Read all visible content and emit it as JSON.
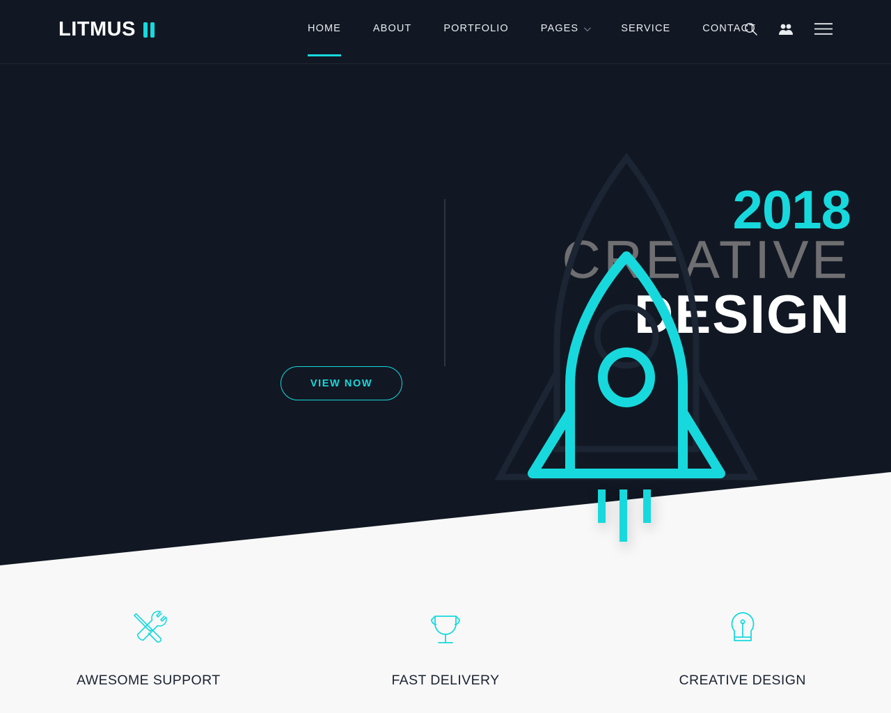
{
  "brand": {
    "name": "LITMUS",
    "accent_color": "#17d9dd",
    "dark_bg": "#111823",
    "light_bg": "#f8f8f8"
  },
  "header": {
    "nav_items": [
      {
        "label": "HOME",
        "active": true,
        "has_dropdown": false
      },
      {
        "label": "ABOUT",
        "active": false,
        "has_dropdown": false
      },
      {
        "label": "PORTFOLIO",
        "active": false,
        "has_dropdown": false
      },
      {
        "label": "PAGES",
        "active": false,
        "has_dropdown": true
      },
      {
        "label": "SERVICE",
        "active": false,
        "has_dropdown": false
      },
      {
        "label": "CONTACT",
        "active": false,
        "has_dropdown": false
      }
    ],
    "icons": [
      {
        "name": "search-icon"
      },
      {
        "name": "users-icon"
      },
      {
        "name": "hamburger-menu-icon"
      }
    ]
  },
  "hero": {
    "year": "2018",
    "line_light": "CREATIVE",
    "line_bold": "DESIGN",
    "cta_label": "VIEW NOW",
    "illustration": "rocket-icon"
  },
  "features": [
    {
      "icon": "tools-icon",
      "label": "AWESOME SUPPORT"
    },
    {
      "icon": "trophy-icon",
      "label": "FAST DELIVERY"
    },
    {
      "icon": "lightbulb-icon",
      "label": "CREATIVE DESIGN"
    }
  ]
}
